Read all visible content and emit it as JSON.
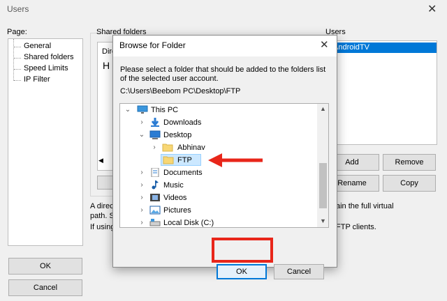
{
  "users_window": {
    "title": "Users",
    "page_label": "Page:",
    "pages": [
      "General",
      "Shared folders",
      "Speed Limits",
      "IP Filter"
    ],
    "shared_folders_label": "Shared folders",
    "directory_header": "Dire",
    "directory_cell": "H",
    "users_label": "Users",
    "selected_user": "AndroidTV",
    "add_label": "Add",
    "remove_label": "Remove",
    "rename_label": "Rename",
    "copy_label": "Copy",
    "desc_left_1": "A direc",
    "desc_left_2": "path. S",
    "desc_left_3": "If using",
    "desc_right_1": "ain the full virtual",
    "desc_right_2": "FTP clients.",
    "ok_label": "OK",
    "cancel_label": "Cancel"
  },
  "dialog": {
    "title": "Browse for Folder",
    "message_line1": "Please select a folder that should be added to the folders list",
    "message_line2": "of the selected user account.",
    "path": "C:\\Users\\Beebom PC\\Desktop\\FTP",
    "tree": [
      {
        "label": "This PC",
        "icon": "monitor-icon",
        "chevron": "down"
      },
      {
        "label": "Downloads",
        "icon": "download-icon",
        "chevron": "right"
      },
      {
        "label": "Desktop",
        "icon": "desktop-icon",
        "chevron": "down"
      },
      {
        "label": "Abhinav",
        "icon": "folder-icon",
        "chevron": "right"
      },
      {
        "label": "FTP",
        "icon": "folder-icon",
        "chevron": "none",
        "selected": true
      },
      {
        "label": "Documents",
        "icon": "documents-icon",
        "chevron": "right"
      },
      {
        "label": "Music",
        "icon": "music-icon",
        "chevron": "right"
      },
      {
        "label": "Videos",
        "icon": "videos-icon",
        "chevron": "right"
      },
      {
        "label": "Pictures",
        "icon": "pictures-icon",
        "chevron": "right"
      },
      {
        "label": "Local Disk (C:)",
        "icon": "drive-icon",
        "chevron": "right"
      }
    ],
    "ok_label": "OK",
    "cancel_label": "Cancel"
  },
  "colors": {
    "selection": "#0078d7",
    "annotation": "#e8261a",
    "folder": "#f8d775"
  }
}
